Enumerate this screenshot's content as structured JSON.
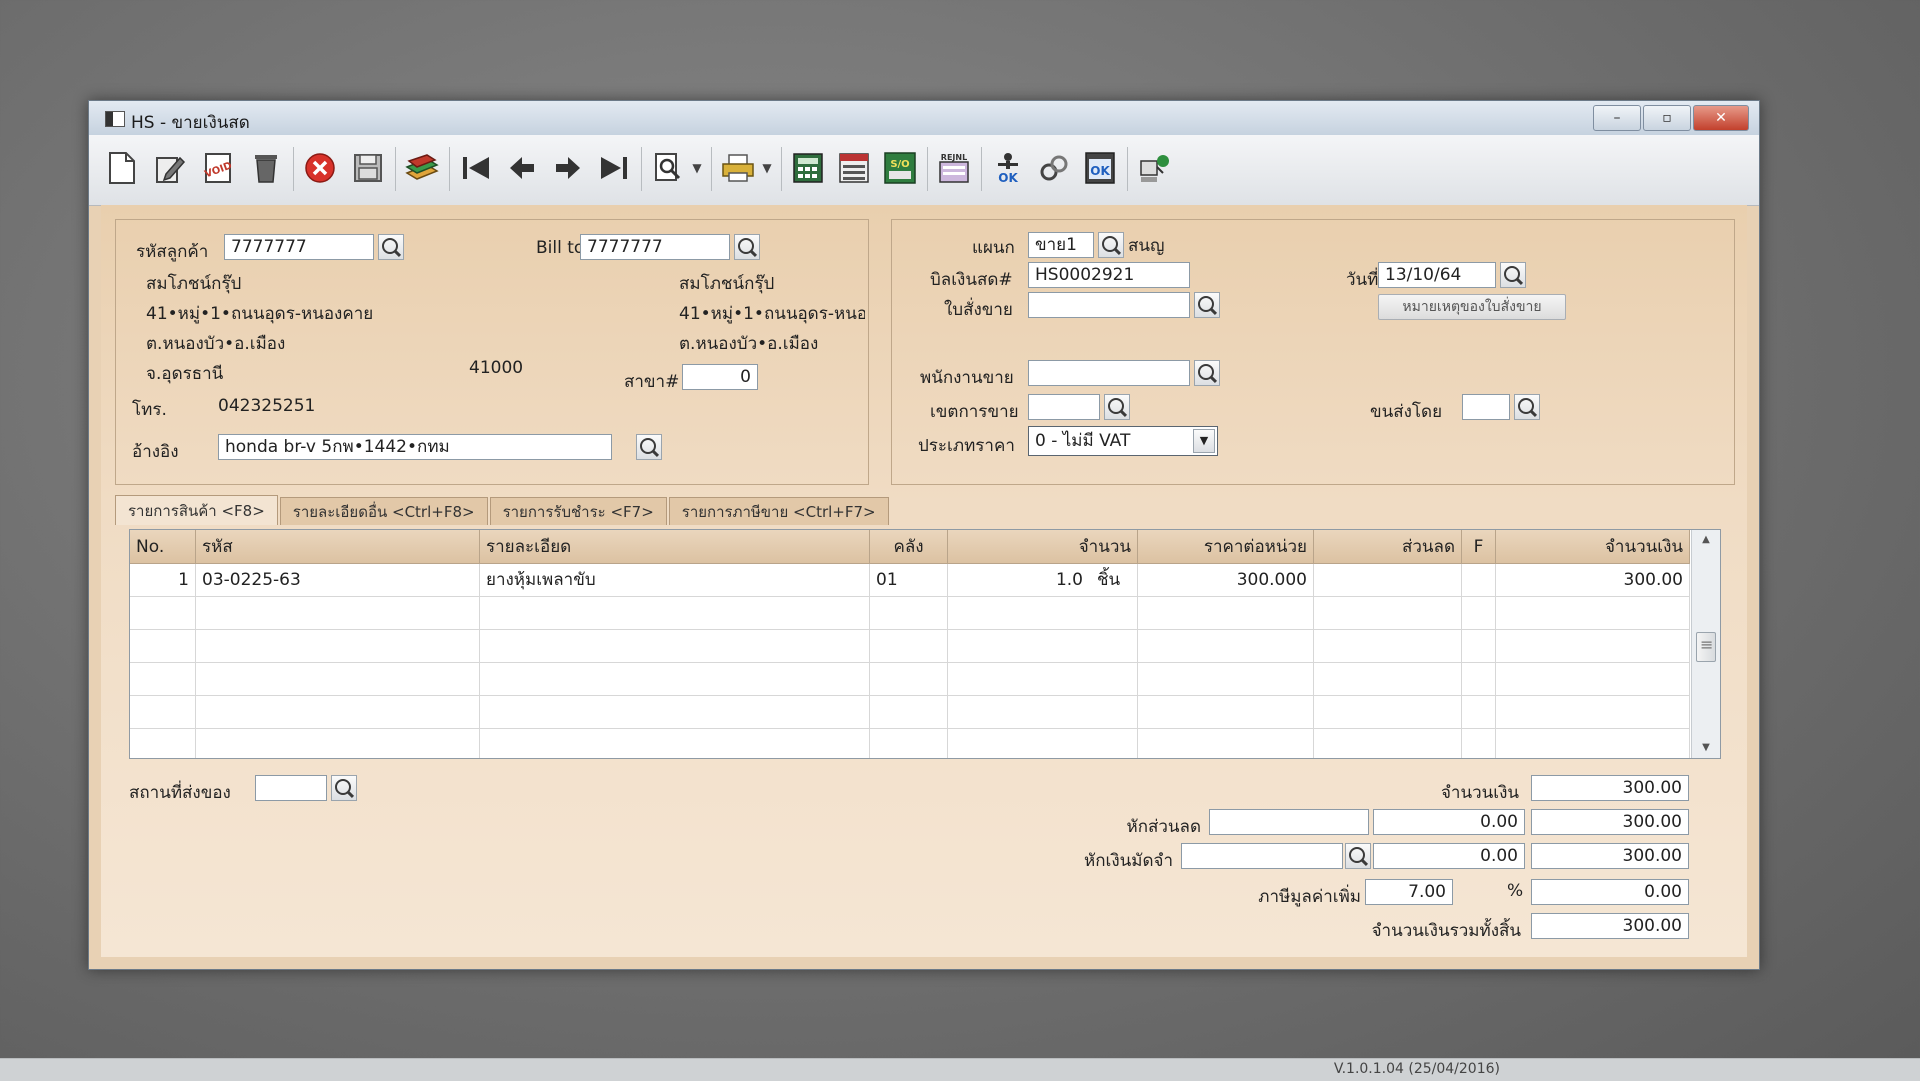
{
  "window": {
    "title": "HS - ขายเงินสด",
    "controls": {
      "minimize": "–",
      "maximize": "▫",
      "close": "✕"
    }
  },
  "toolbar": {
    "icons": [
      "new-document-icon",
      "edit-icon",
      "void-icon",
      "delete-icon",
      "cancel-icon",
      "save-icon",
      "books-icon",
      "first-record-icon",
      "previous-record-icon",
      "next-record-icon",
      "last-record-icon",
      "search-document-icon",
      "print-icon",
      "calculator-report-icon",
      "list-report-icon",
      "so-report-icon",
      "rejnl-icon",
      "approve-ok-icon",
      "link-icon",
      "ok-icon",
      "network-icon"
    ],
    "labels": {
      "void": "VOID",
      "so": "S/O",
      "rejnl": "REJNL",
      "ok": "OK"
    }
  },
  "customer": {
    "code_label": "รหัสลูกค้า",
    "code": "7777777",
    "bill_to_label": "Bill to",
    "bill_to": "7777777",
    "name": "สมโภชน์กรุ๊ป",
    "address1": "41•หมู่•1•ถนนอุดร-หนองคาย",
    "address2": "ต.หนองบัว•อ.เมือง",
    "province": "จ.อุดรธานี",
    "postcode": "41000",
    "bill_name": "สมโภชน์กรุ๊ป",
    "bill_address1": "41•หมู่•1•ถนนอุดร-หนอ",
    "bill_address2": "ต.หนองบัว•อ.เมือง",
    "branch_label": "สาขา#",
    "branch": "0",
    "phone_label": "โทร.",
    "phone": "042325251",
    "reference_label": "อ้างอิง",
    "reference": "honda br-v 5กพ•1442•กทม"
  },
  "document": {
    "department_label": "แผนก",
    "department": "ขาย1",
    "department_name": "สนญ",
    "invoice_label": "บิลเงินสด#",
    "invoice": "HS0002921",
    "date_label": "วันที่",
    "date": "13/10/64",
    "sales_order_label": "ใบสั่งขาย",
    "sales_order": "",
    "so_note_button": "หมายเหตุของใบสั่งขาย",
    "salesperson_label": "พนักงานขาย",
    "salesperson": "",
    "sales_area_label": "เขตการขาย",
    "sales_area": "",
    "shipped_by_label": "ขนส่งโดย",
    "shipped_by": "",
    "price_type_label": "ประเภทราคา",
    "price_type": "0 - ไม่มี VAT"
  },
  "tabs": [
    "รายการสินค้า <F8>",
    "รายละเอียดอื่น <Ctrl+F8>",
    "รายการรับชำระ <F7>",
    "รายการภาษีขาย <Ctrl+F7>"
  ],
  "grid": {
    "headers": [
      "No.",
      "รหัส",
      "รายละเอียด",
      "คลัง",
      "จำนวน",
      "ราคาต่อหน่วย",
      "ส่วนลด",
      "F",
      "จำนวนเงิน"
    ],
    "rows": [
      {
        "no": "1",
        "code": "03-0225-63",
        "description": "ยางหุ้มเพลาขับ",
        "warehouse": "01",
        "qty": "1.0",
        "unit": "ชิ้น",
        "unit_price": "300.000",
        "discount": "",
        "f": "",
        "amount": "300.00"
      }
    ]
  },
  "footer": {
    "ship_to_label": "สถานที่ส่งของ",
    "ship_to": "",
    "amount_label": "จำนวนเงิน",
    "amount": "300.00",
    "discount_label": "หักส่วนลด",
    "discount_input": "",
    "discount_value": "0.00",
    "after_discount": "300.00",
    "deposit_label": "หักเงินมัดจำ",
    "deposit_input": "",
    "deposit_value": "0.00",
    "after_deposit": "300.00",
    "vat_label": "ภาษีมูลค่าเพิ่ม",
    "vat_rate": "7.00",
    "vat_percent_sign": "%",
    "vat_amount": "0.00",
    "total_label": "จำนวนเงินรวมทั้งสิ้น",
    "total": "300.00"
  },
  "status_bar": {
    "version": "V.1.0.1.04 (25/04/2016)"
  }
}
